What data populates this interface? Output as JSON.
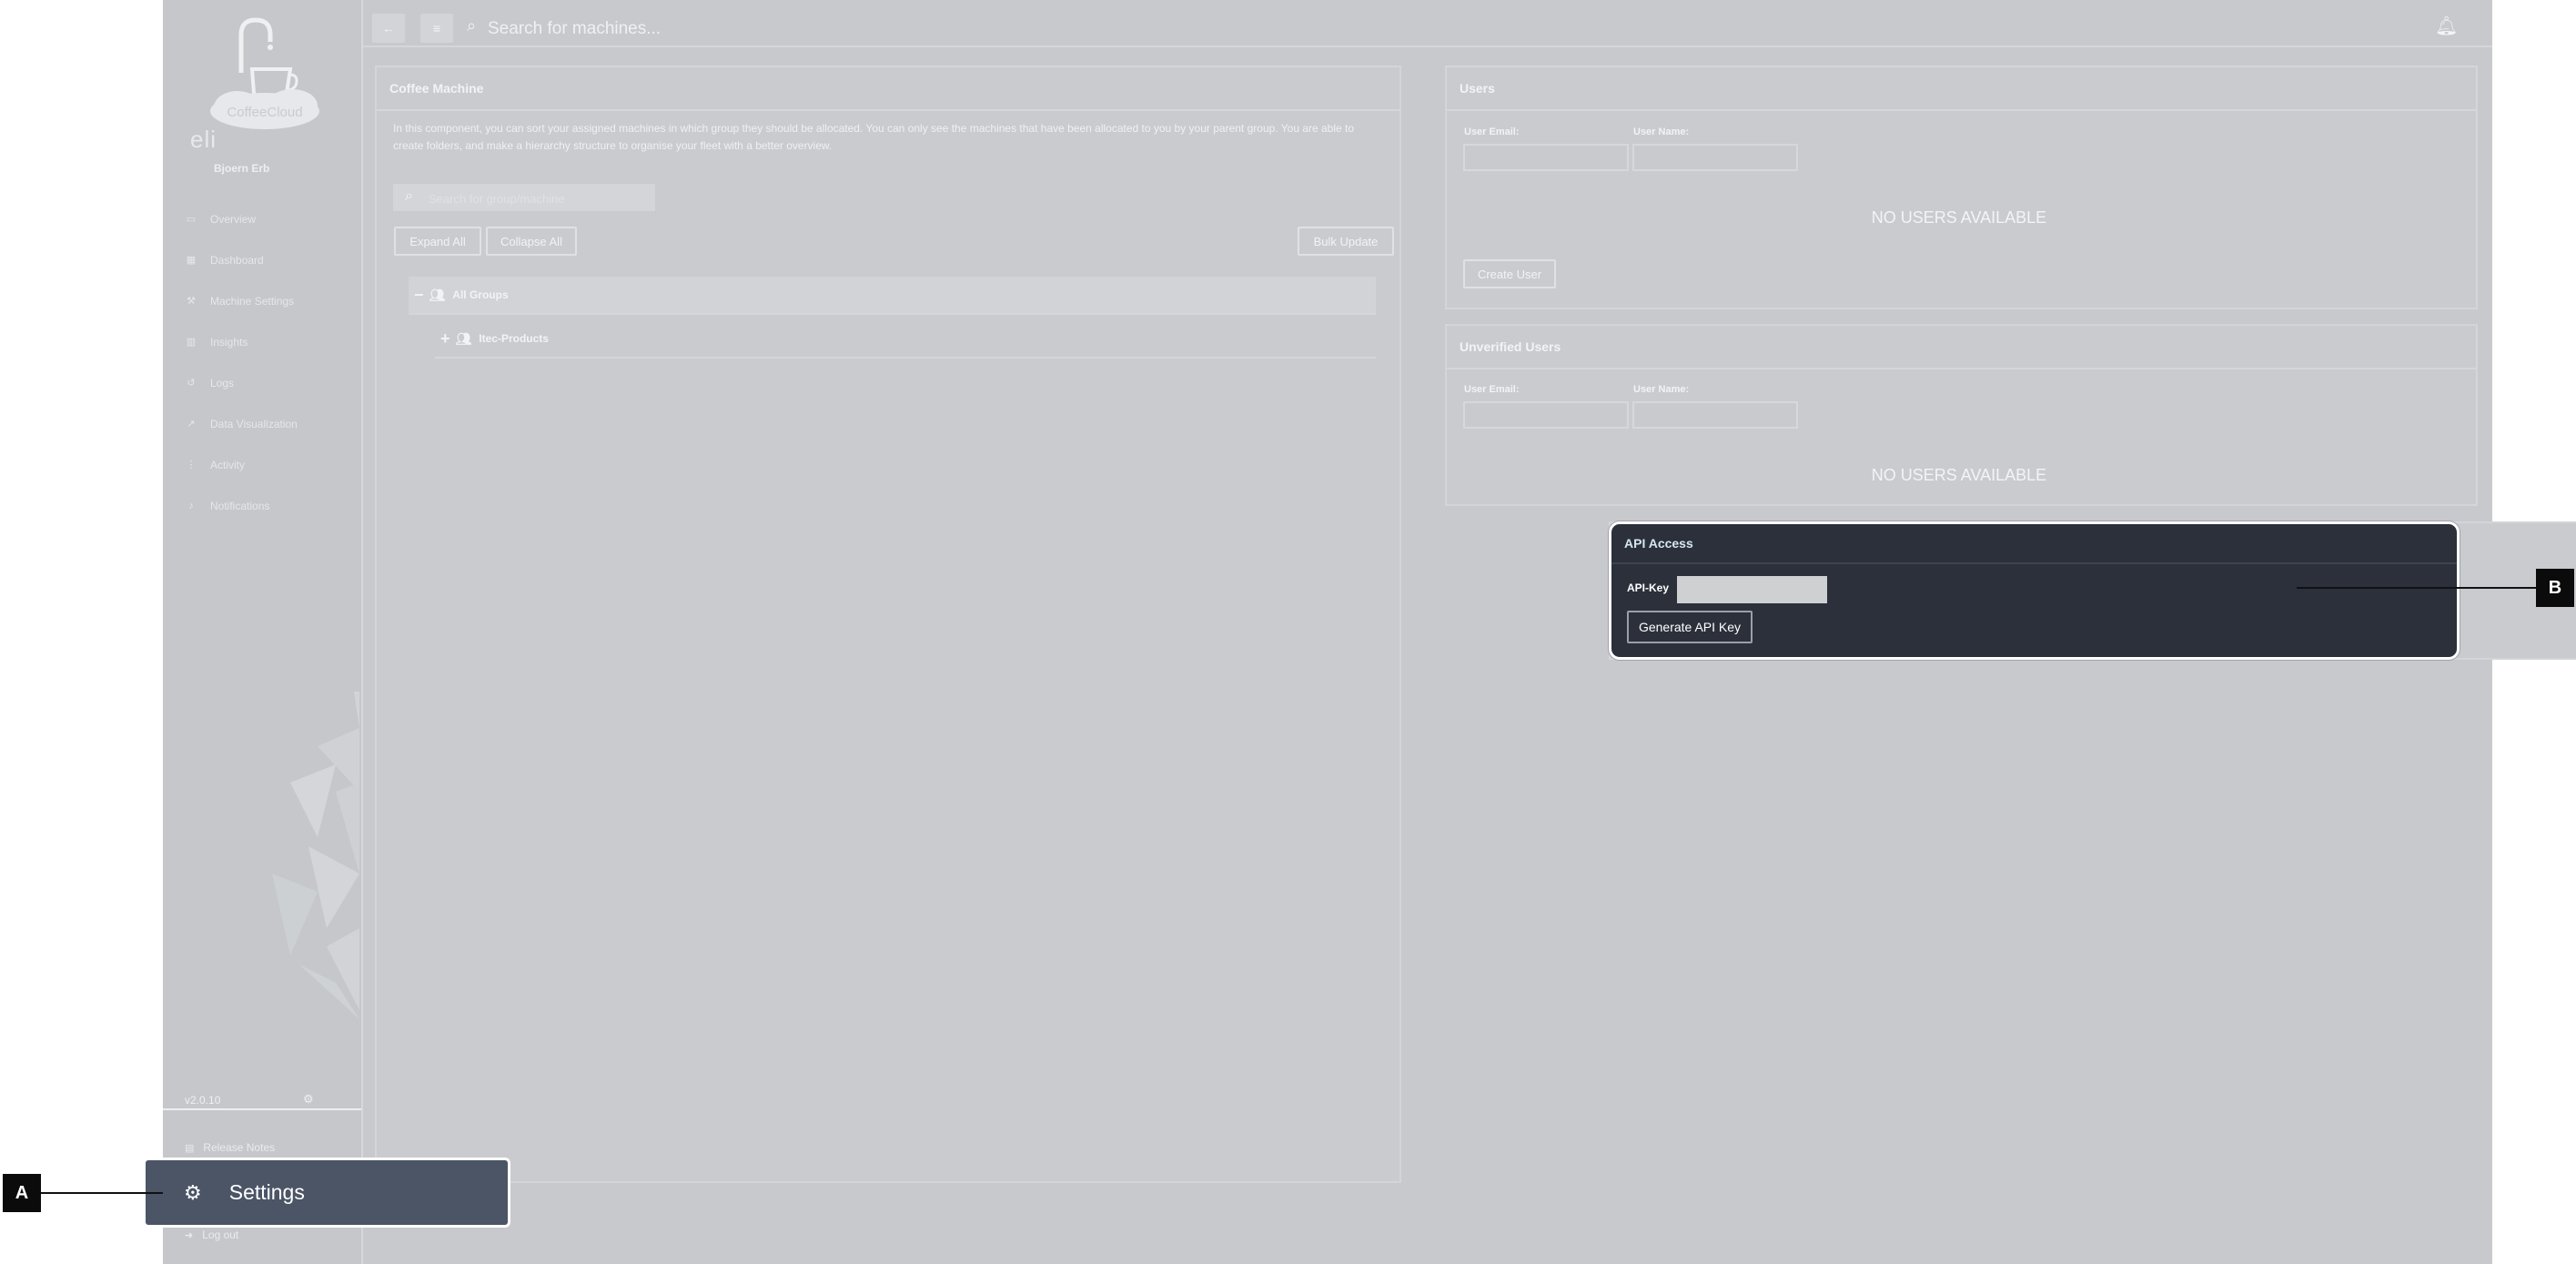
{
  "sidebar": {
    "brand": "CoffeeCloud",
    "company": "eli",
    "user_name": "Bjoern Erb",
    "items": [
      {
        "label": "Overview",
        "icon": "monitor-icon"
      },
      {
        "label": "Dashboard",
        "icon": "grid-icon"
      },
      {
        "label": "Machine Settings",
        "icon": "wrench-icon"
      },
      {
        "label": "Insights",
        "icon": "bar-chart-icon"
      },
      {
        "label": "Logs",
        "icon": "history-icon"
      },
      {
        "label": "Data Visualization",
        "icon": "line-chart-icon"
      },
      {
        "label": "Activity",
        "icon": "activity-icon"
      },
      {
        "label": "Notifications",
        "icon": "bell-icon"
      }
    ],
    "version": "v2.0.10",
    "release_notes": "Release Notes",
    "settings": "Settings",
    "logout": "Log out"
  },
  "topbar": {
    "search_placeholder": "Search for machines..."
  },
  "coffee_panel": {
    "title": "Coffee Machine",
    "description": "In this component, you can sort your assigned machines in which group they should be allocated. You can only see the machines that have been allocated to you by your parent group. You are able to create folders, and make a hierarchy structure to organise your fleet with a better overview.",
    "search_placeholder": "Search for group/machine",
    "expand_all": "Expand All",
    "collapse_all": "Collapse All",
    "bulk_update": "Bulk Update",
    "tree": [
      {
        "label": "All Groups",
        "sign": "−"
      },
      {
        "label": "Itec-Products",
        "sign": "+"
      }
    ]
  },
  "users_panel": {
    "title": "Users",
    "email_label": "User Email:",
    "name_label": "User Name:",
    "empty": "NO USERS AVAILABLE",
    "create_user": "Create User"
  },
  "unverified_panel": {
    "title": "Unverified Users",
    "email_label": "User Email:",
    "name_label": "User Name:",
    "empty": "NO USERS AVAILABLE"
  },
  "api_panel": {
    "title": "API Access",
    "key_label": "API-Key",
    "generate": "Generate API Key"
  },
  "callouts": {
    "a": "A",
    "b": "B"
  },
  "colors": {
    "highlight_dark": "#2b303b",
    "settings_highlight": "#4b5566",
    "dimmed_bg": "#c8c9cd"
  }
}
